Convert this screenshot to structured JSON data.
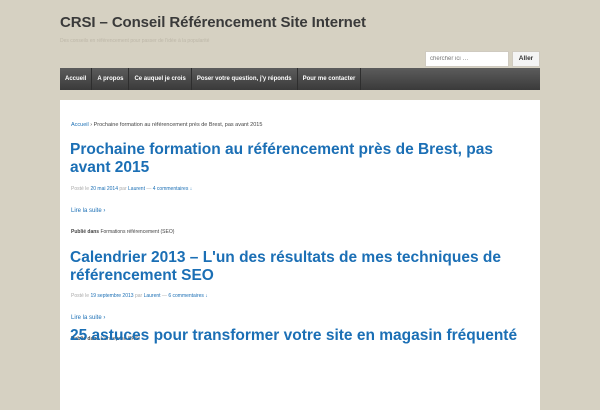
{
  "header": {
    "site_title": "CRSI – Conseil Référencement Site Internet",
    "site_description": "Des conseils en référencement pour passer de l'idée à la popularité"
  },
  "search": {
    "placeholder": "chercher ici …",
    "button_label": "Aller"
  },
  "nav": {
    "items": [
      {
        "label": "Accueil"
      },
      {
        "label": "A propos"
      },
      {
        "label": "Ce auquel je crois"
      },
      {
        "label": "Poser votre question, j'y réponds"
      },
      {
        "label": "Pour me contacter"
      }
    ]
  },
  "breadcrumb": {
    "home": "Accueil",
    "separator": " › ",
    "current": "Prochaine formation au référencement près de Brest, pas avant 2015"
  },
  "posts": [
    {
      "title": "Prochaine formation au référencement près de Brest, pas avant 2015",
      "posted_on": "Posté le ",
      "date": "20 mai 2014",
      "by": " par ",
      "author": "Laurent",
      "dash": " — ",
      "comments": "4 commentaires ↓",
      "read_more": "Lire la suite ›",
      "published_in": "Publié dans ",
      "category": "Formations référencement (SEO)"
    },
    {
      "title": "Calendrier 2013 – L'un des résultats de mes techniques de référencement SEO",
      "posted_on": "Posté le ",
      "date": "19 septembre 2013",
      "by": " par ",
      "author": "Laurent",
      "dash": " — ",
      "comments": "6 commentaires ↓",
      "read_more": "Lire la suite ›",
      "published_in": "Publié dans ",
      "category": "L'entreprise CRSI"
    },
    {
      "title": "25 astuces pour transformer votre site en magasin fréquenté"
    }
  ]
}
